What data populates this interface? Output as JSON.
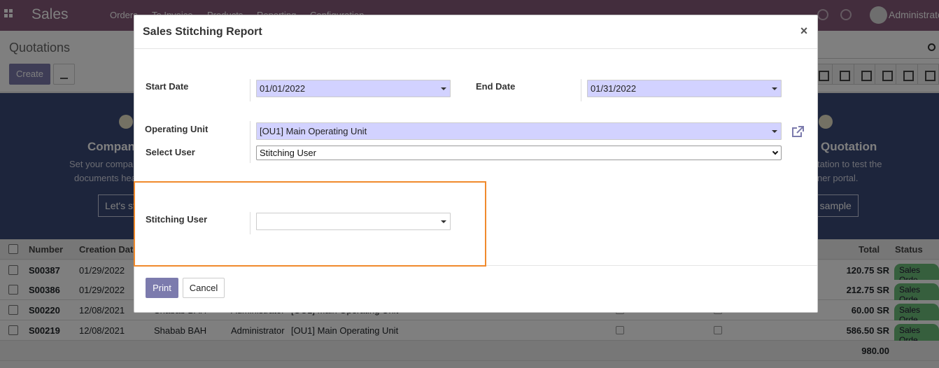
{
  "app": {
    "title": "Sales",
    "menu": [
      "Orders",
      "To Invoice",
      "Products",
      "Reporting",
      "Configuration"
    ],
    "user": "Administrator"
  },
  "control_panel": {
    "breadcrumb": "Quotations",
    "create_label": "Create",
    "search_placeholder": ""
  },
  "banner": {
    "left_title": "Company",
    "left_text_1": "Set your compa",
    "left_text_2": "documents hea",
    "left_button": "Let's st",
    "right_title": "Quotation",
    "right_text_1": "tation to test the",
    "right_text_2": "ner portal.",
    "right_button": "d sample"
  },
  "table": {
    "columns": {
      "number": "Number",
      "creation_date": "Creation Dat",
      "total": "Total",
      "status": "Status"
    },
    "rows": [
      {
        "number": "S00387",
        "date": "01/29/2022",
        "customer": "",
        "salesperson": "",
        "unit": "",
        "total": "120.75 SR",
        "status": "Sales Orde"
      },
      {
        "number": "S00386",
        "date": "01/29/2022",
        "customer": "",
        "salesperson": "",
        "unit": "",
        "total": "212.75 SR",
        "status": "Sales Orde"
      },
      {
        "number": "S00220",
        "date": "12/08/2021",
        "customer": "Shabab BAH",
        "salesperson": "Administrator",
        "unit": "[OU1] Main Operating Unit",
        "total": "60.00 SR",
        "status": "Sales Orde"
      },
      {
        "number": "S00219",
        "date": "12/08/2021",
        "customer": "Shabab BAH",
        "salesperson": "Administrator",
        "unit": "[OU1] Main Operating Unit",
        "total": "586.50 SR",
        "status": "Sales Orde"
      }
    ],
    "footer_total": "980.00"
  },
  "dialog": {
    "title": "Sales Stitching Report",
    "close_label": "×",
    "start_date_label": "Start Date",
    "start_date_value": "01/01/2022",
    "end_date_label": "End Date",
    "end_date_value": "01/31/2022",
    "operating_unit_label": "Operating Unit",
    "operating_unit_value": "[OU1] Main Operating Unit",
    "select_user_label": "Select User",
    "select_user_value": "Stitching User",
    "stitching_user_label": "Stitching User",
    "stitching_user_value": "",
    "print_label": "Print",
    "cancel_label": "Cancel"
  },
  "colors": {
    "brand": "#875a7b",
    "primary_button": "#7c7bad",
    "required_field": "#d2d2ff",
    "highlight_box": "#f08a2c",
    "status_badge": "#6dbf7a"
  }
}
